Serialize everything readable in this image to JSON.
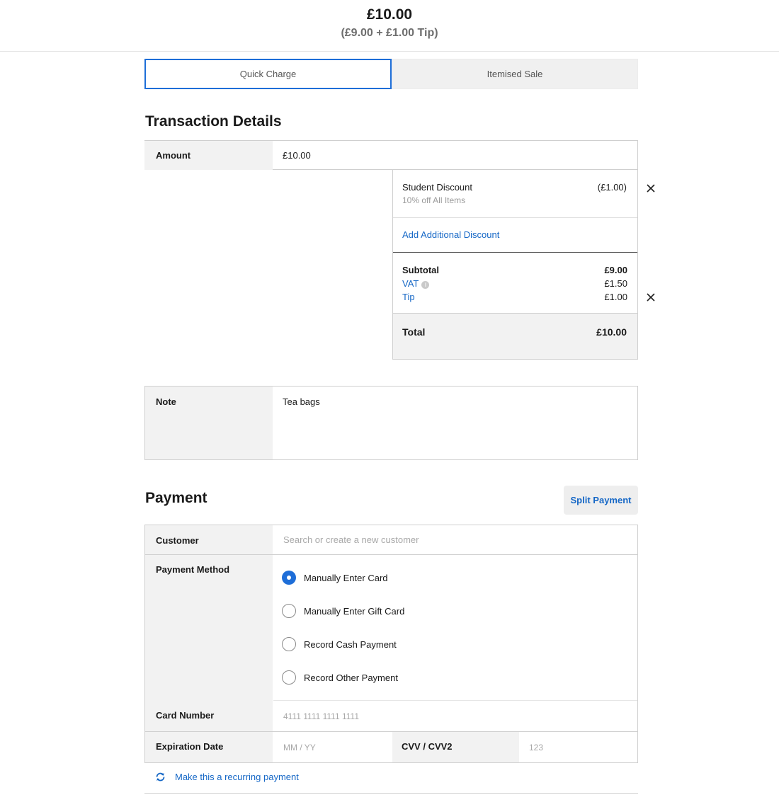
{
  "header": {
    "total": "£10.00",
    "breakdown": "(£9.00 + £1.00 Tip)"
  },
  "tabs": [
    {
      "label": "Quick Charge",
      "active": true
    },
    {
      "label": "Itemised Sale",
      "active": false
    }
  ],
  "transaction": {
    "title": "Transaction Details",
    "amount_label": "Amount",
    "amount_value": "£10.00",
    "discount": {
      "name": "Student Discount",
      "description": "10% off All Items",
      "amount": "(£1.00)"
    },
    "add_discount_label": "Add Additional Discount",
    "subtotal_label": "Subtotal",
    "subtotal_value": "£9.00",
    "vat_label": "VAT",
    "vat_value": "£1.50",
    "tip_label": "Tip",
    "tip_value": "£1.00",
    "total_label": "Total",
    "total_value": "£10.00",
    "note_label": "Note",
    "note_value": "Tea bags"
  },
  "payment": {
    "title": "Payment",
    "split_label": "Split Payment",
    "customer_label": "Customer",
    "customer_placeholder": "Search or create a new customer",
    "method_label": "Payment Method",
    "methods": [
      {
        "label": "Manually Enter Card",
        "selected": true
      },
      {
        "label": "Manually Enter Gift Card",
        "selected": false
      },
      {
        "label": "Record Cash Payment",
        "selected": false
      },
      {
        "label": "Record Other Payment",
        "selected": false
      }
    ],
    "card_number_label": "Card Number",
    "card_number_placeholder": "4111 1111 1111 1111",
    "expiration_label": "Expiration Date",
    "expiration_placeholder": "MM / YY",
    "cvv_label": "CVV / CVV2",
    "cvv_placeholder": "123",
    "recurring_label": "Make this a recurring payment"
  },
  "colors": {
    "accent": "#1e6ed8",
    "link": "#1567c6",
    "label_bg": "#f2f2f2"
  }
}
